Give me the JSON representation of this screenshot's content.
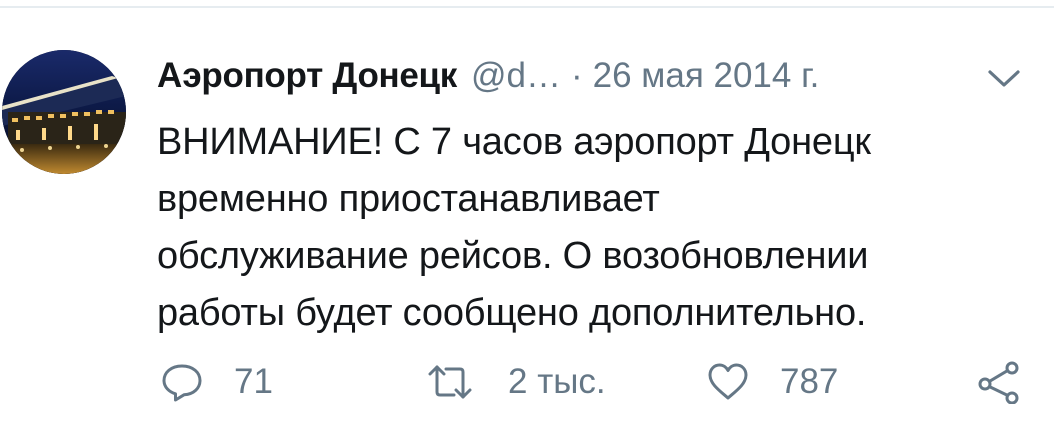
{
  "tweet": {
    "author": {
      "display_name": "Аэропорт Донецк",
      "handle": "@d…",
      "avatar_icon": "airport-night-photo"
    },
    "separator": "·",
    "timestamp": "26 мая 2014 г.",
    "menu_icon": "chevron-down-icon",
    "text": "ВНИМАНИЕ! С 7 часов аэропорт Донецк\nвременно приостанавливает\nобслуживание рейсов. О возобновлении\nработы будет сообщено дополнительно.",
    "actions": {
      "reply": {
        "icon": "reply-icon",
        "count": "71"
      },
      "retweet": {
        "icon": "retweet-icon",
        "count": "2 тыс."
      },
      "like": {
        "icon": "heart-icon",
        "count": "787"
      },
      "share": {
        "icon": "share-icon"
      }
    }
  },
  "colors": {
    "primary_text": "#14171a",
    "secondary_text": "#657786",
    "divider": "#e6ecf0"
  }
}
